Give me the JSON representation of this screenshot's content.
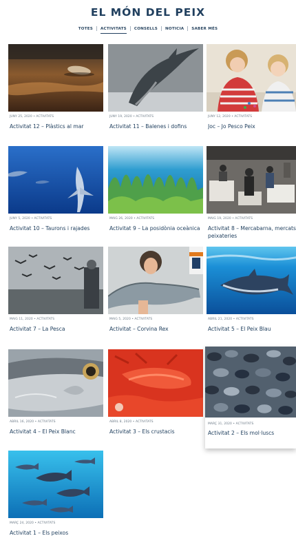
{
  "site": {
    "title": "EL MÓN DEL PEIX"
  },
  "nav": [
    {
      "label": "TOTES",
      "active": false
    },
    {
      "label": "ACTIVITATS",
      "active": true
    },
    {
      "label": "CONSELLS",
      "active": false
    },
    {
      "label": "NOTICIA",
      "active": false
    },
    {
      "label": "SABER MÉS",
      "active": false
    }
  ],
  "cards": [
    {
      "meta": "JUNY 25, 2020 • ACTIVITATS",
      "title": "Activitat 12 – Plàstics al mar"
    },
    {
      "meta": "JUNY 19, 2020 • ACTIVITATS",
      "title": "Activitat 11 – Balenes i dofins"
    },
    {
      "meta": "JUNY 12, 2020 • ACTIVITATS",
      "title": "Joc – Jo Pesco Peix"
    },
    {
      "meta": "JUNY 5, 2020 • ACTIVITATS",
      "title": "Activitat 10 – Taurons i rajades"
    },
    {
      "meta": "MAIG 26, 2020 • ACTIVITATS",
      "title": "Activitat 9 – La posidònia oceànica"
    },
    {
      "meta": "MAIG 19, 2020 • ACTIVITATS",
      "title": "Activitat 8 – Mercabarna, mercats i peixateries"
    },
    {
      "meta": "MAIG 11, 2020 • ACTIVITATS",
      "title": "Activitat 7 – La Pesca"
    },
    {
      "meta": "MAIG 5, 2020 • ACTIVITATS",
      "title": "Activitat – Corvina Rex"
    },
    {
      "meta": "ABRIL 21, 2020 • ACTIVITATS",
      "title": "Activitat 5 – El Peix Blau"
    },
    {
      "meta": "ABRIL 16, 2020 • ACTIVITATS",
      "title": "Activitat 4 – El Peix Blanc"
    },
    {
      "meta": "ABRIL 8, 2020 • ACTIVITATS",
      "title": "Activitat 3 – Els crustacis"
    },
    {
      "meta": "MARÇ 31, 2020 • ACTIVITATS",
      "title": "Activitat 2 – Els mol·luscs"
    },
    {
      "meta": "MARÇ 24, 2020 • ACTIVITATS",
      "title": "Activitat 1 – Els peixos"
    }
  ]
}
